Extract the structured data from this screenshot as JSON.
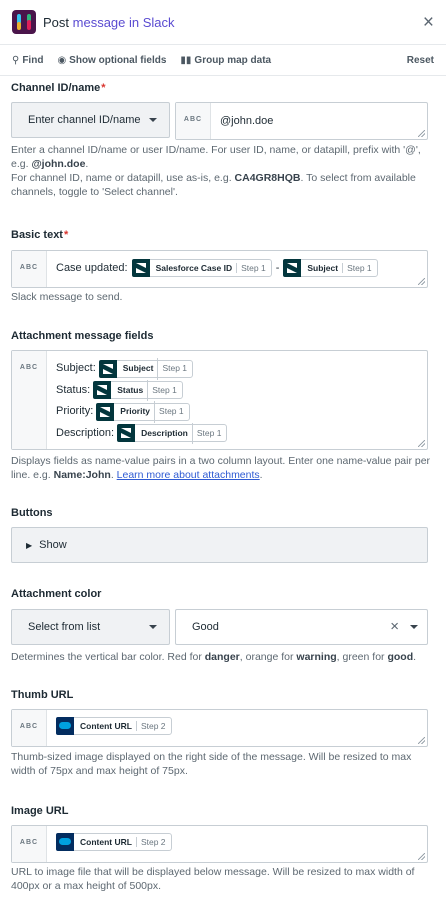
{
  "header": {
    "prefix": "Post",
    "action": "message in",
    "app": "Slack",
    "close": "×"
  },
  "toolbar": {
    "find": "Find",
    "show_optional": "Show optional fields",
    "group_map": "Group map data",
    "reset": "Reset"
  },
  "channel": {
    "label": "Channel ID/name",
    "required": "*",
    "mode": "Enter channel ID/name",
    "type": "ABC",
    "value": "@john.doe",
    "help1a": "Enter a channel ID/name or user ID/name. For user ID, name, or datapill, prefix with '@', e.g.",
    "help1b": "@john.doe",
    "help2a": "For channel ID, name or datapill, use as-is, e.g.",
    "help2b": "CA4GR8HQB",
    "help2c": ". To select from available channels, toggle to 'Select channel'."
  },
  "basic_text": {
    "label": "Basic text",
    "required": "*",
    "type": "ABC",
    "prefix": "Case updated:",
    "pill1": "Salesforce Case ID",
    "step1": "Step 1",
    "sep": "-",
    "pill2": "Subject",
    "step2": "Step 1",
    "help": "Slack message to send."
  },
  "attachment": {
    "label": "Attachment message fields",
    "type": "ABC",
    "rows": [
      {
        "k": "Subject:",
        "v": "Subject",
        "s": "Step 1"
      },
      {
        "k": "Status:",
        "v": "Status",
        "s": "Step 1"
      },
      {
        "k": "Priority:",
        "v": "Priority",
        "s": "Step 1"
      },
      {
        "k": "Description:",
        "v": "Description",
        "s": "Step 1"
      }
    ],
    "help_a": "Displays fields as name-value pairs in a two column layout. Enter one name-value pair per line. e.g.",
    "help_b": "Name:John",
    "help_c": "Learn more about attachments"
  },
  "buttons": {
    "label": "Buttons",
    "show": "Show"
  },
  "color": {
    "label": "Attachment color",
    "mode": "Select from list",
    "value": "Good",
    "clear": "×",
    "help_a": "Determines the vertical bar color. Red for",
    "help_b": "danger",
    "help_c": ", orange for",
    "help_d": "warning",
    "help_e": ", green for",
    "help_f": "good"
  },
  "thumb": {
    "label": "Thumb URL",
    "type": "ABC",
    "pill": "Content URL",
    "step": "Step 2",
    "help": "Thumb-sized image displayed on the right side of the message. Will be resized to max width of 75px and max height of 75px."
  },
  "image": {
    "label": "Image URL",
    "type": "ABC",
    "pill": "Content URL",
    "step": "Step 2",
    "help": "URL to image file that will be displayed below message. Will be resized to max width of 400px or a max height of 500px."
  },
  "colors": {
    "accent": "#5a4bd1",
    "required": "#d9352f",
    "zendesk": "#03363d",
    "salesforce": "#00a1e0"
  }
}
